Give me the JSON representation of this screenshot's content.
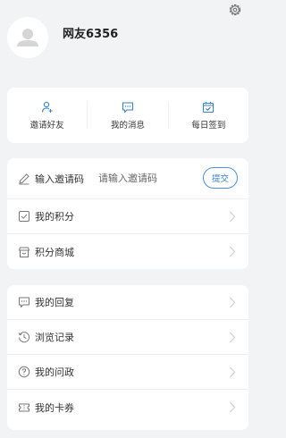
{
  "profile": {
    "username": "网友6356"
  },
  "quick_actions": [
    {
      "label": "邀请好友",
      "icon": "person-add-icon"
    },
    {
      "label": "我的消息",
      "icon": "message-icon"
    },
    {
      "label": "每日签到",
      "icon": "calendar-check-icon"
    }
  ],
  "invite": {
    "label": "输入邀请码",
    "placeholder": "请输入邀请码",
    "submit_label": "提交"
  },
  "menu1": [
    {
      "label": "我的积分",
      "icon": "checkbox-icon"
    },
    {
      "label": "积分商城",
      "icon": "shop-icon"
    }
  ],
  "menu2": [
    {
      "label": "我的回复",
      "icon": "chat-bubble-icon"
    },
    {
      "label": "浏览记录",
      "icon": "history-icon"
    },
    {
      "label": "我的问政",
      "icon": "question-icon"
    },
    {
      "label": "我的卡券",
      "icon": "ticket-icon"
    }
  ],
  "colors": {
    "accent": "#3b82c4",
    "background": "#f2f3f5"
  }
}
